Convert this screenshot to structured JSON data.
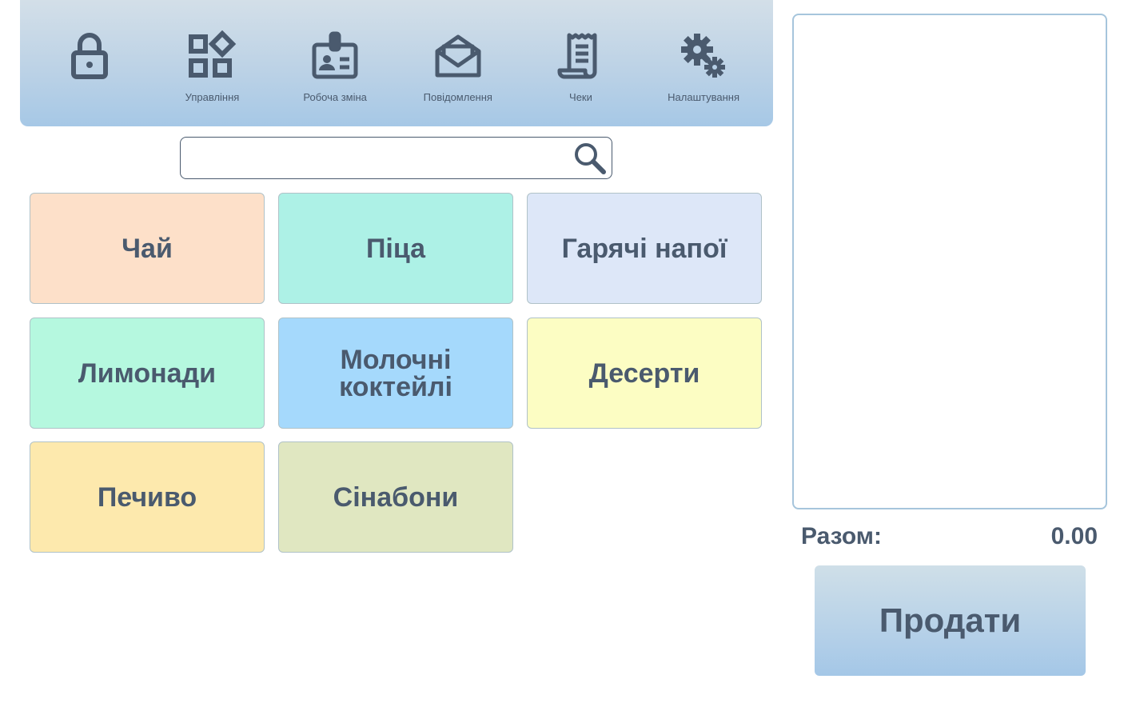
{
  "toolbar": {
    "items": [
      {
        "label": "",
        "icon": "lock-icon"
      },
      {
        "label": "Управління",
        "icon": "widgets-icon"
      },
      {
        "label": "Робоча зміна",
        "icon": "id-badge-icon"
      },
      {
        "label": "Повідомлення",
        "icon": "envelope-open-icon"
      },
      {
        "label": "Чеки",
        "icon": "receipt-icon"
      },
      {
        "label": "Налаштування",
        "icon": "gears-icon"
      }
    ]
  },
  "search": {
    "value": "",
    "placeholder": "",
    "icon": "search-icon"
  },
  "categories": [
    {
      "label": "Чай",
      "color": "#fde0c9"
    },
    {
      "label": "Піца",
      "color": "#adf1e6"
    },
    {
      "label": "Гарячі напої",
      "color": "#dde7f8"
    },
    {
      "label": "Лимонади",
      "color": "#b5f8df"
    },
    {
      "label": "Молочні коктейлі",
      "color": "#a5d9fc"
    },
    {
      "label": "Десерти",
      "color": "#fcfdc3"
    },
    {
      "label": "Печиво",
      "color": "#fde9ad"
    },
    {
      "label": "Сінабони",
      "color": "#e0e7c1"
    }
  ],
  "summary": {
    "total_label": "Разом:",
    "total_value": "0.00"
  },
  "sell_label": "Продати",
  "colors": {
    "text": "#4a5a6e",
    "toolbar": "#bcd2e6",
    "border": "#a6c5dc"
  }
}
